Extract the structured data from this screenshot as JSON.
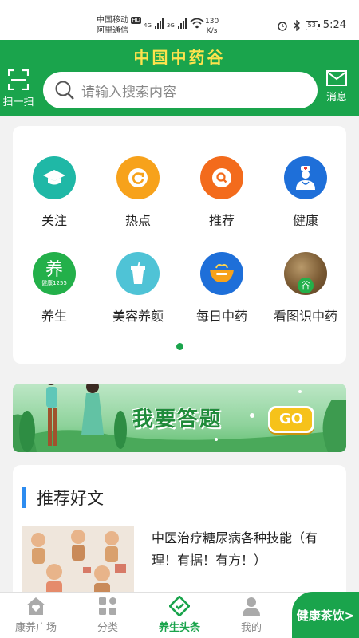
{
  "status_bar": {
    "carrier1": "中国移动",
    "hd": "HD",
    "carrier2": "阿里通信",
    "net1": "4G",
    "net2": "3G",
    "speed_value": "130",
    "speed_unit": "K/s",
    "battery": "53",
    "time": "5:24"
  },
  "header": {
    "app_title": "中国中药谷",
    "scan_label": "扫一扫",
    "search_placeholder": "请输入搜索内容",
    "message_label": "消息"
  },
  "categories": [
    {
      "label": "关注",
      "icon": "graduation-cap-icon",
      "color": "#1fb8a6"
    },
    {
      "label": "热点",
      "icon": "refresh-icon",
      "color": "#f7a21b"
    },
    {
      "label": "推荐",
      "icon": "search-icon",
      "color": "#f36b1c"
    },
    {
      "label": "健康",
      "icon": "doctor-icon",
      "color": "#1e6fd9"
    },
    {
      "label": "养生",
      "icon": "yangsheng-logo-icon",
      "icon_text": "养",
      "icon_subtext": "健康1255",
      "color": "#23b04a"
    },
    {
      "label": "美容养颜",
      "icon": "cup-icon",
      "color": "#4fc3d6"
    },
    {
      "label": "每日中药",
      "icon": "herb-bowl-icon",
      "color": "#1e6fd9"
    },
    {
      "label": "看图识中药",
      "icon": "herb-photo-icon",
      "icon_text": "谷",
      "color": "#8b6b3d"
    }
  ],
  "banner": {
    "text": "我要答题",
    "go_label": "GO"
  },
  "articles_section": {
    "title": "推荐好文",
    "items": [
      {
        "title": "中医治疗糖尿病各种技能（有理！有据！有方！）"
      }
    ]
  },
  "tab_bar": {
    "tabs": [
      {
        "label": "康养广场",
        "icon": "home-heart-icon",
        "active": false
      },
      {
        "label": "分类",
        "icon": "category-grid-icon",
        "active": false
      },
      {
        "label": "养生头条",
        "icon": "headline-icon",
        "active": true
      },
      {
        "label": "我的",
        "icon": "user-icon",
        "active": false
      }
    ],
    "tea_button": "健康茶饮>"
  },
  "colors": {
    "brand_green": "#1aa44c",
    "title_yellow": "#ffe34d",
    "section_accent": "#2d8cf0"
  }
}
